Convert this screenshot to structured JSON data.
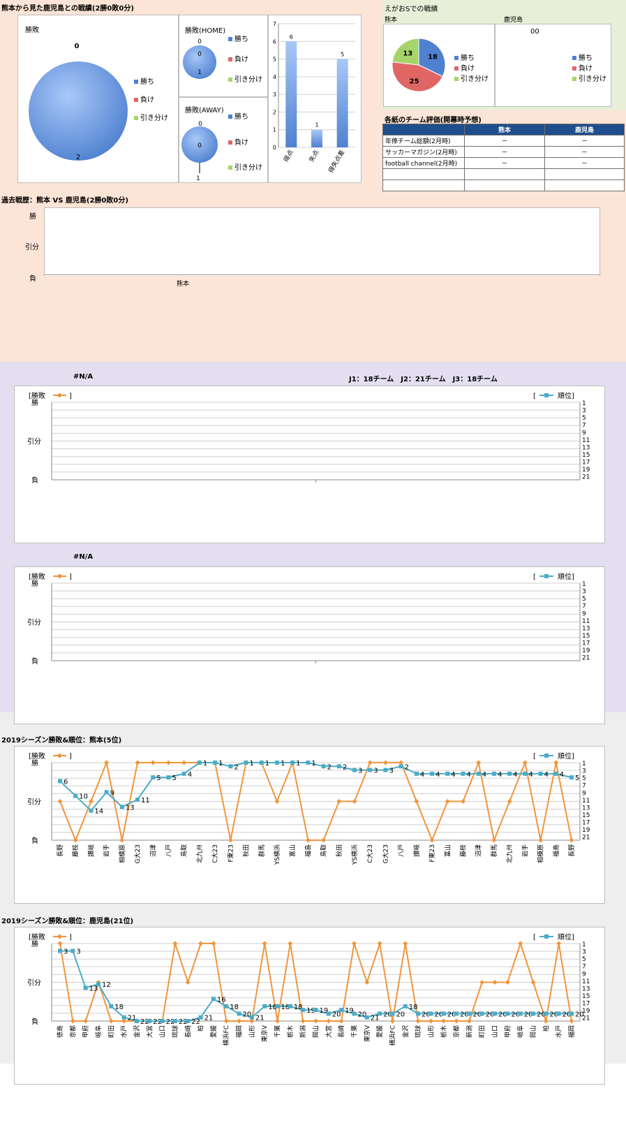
{
  "section1": {
    "title": "熊本から見た鹿児島との戦績(2勝0敗0分)",
    "overall_pie": {
      "label": "勝敗",
      "win": 2,
      "draw": 0
    },
    "home_pie": {
      "label": "勝敗(HOME)",
      "win": 1,
      "loss": 0,
      "draw": 0
    },
    "away_pie": {
      "label": "勝敗(AWAY)",
      "win": 0,
      "loss": 0,
      "draw": 1
    },
    "legend": {
      "win": "勝ち",
      "loss": "負け",
      "draw": "引き分け"
    },
    "goals_bar": {
      "yticks": [
        "0",
        "1",
        "2",
        "3",
        "4",
        "5",
        "6",
        "7"
      ],
      "categories": [
        "得点",
        "失点",
        "得失点差"
      ],
      "values": [
        6,
        1,
        5
      ]
    }
  },
  "egao": {
    "title": "えがおSでの戦績",
    "kumamoto_label": "熊本",
    "kagoshima_label": "鹿児島",
    "kumamoto_pie": {
      "win": 18,
      "loss": 25,
      "draw": 13
    },
    "kagoshima_pie_text": "00"
  },
  "eval_table": {
    "title": "各紙のチーム評価(開幕時予想)",
    "headers": [
      "",
      "熊本",
      "鹿児島"
    ],
    "rows": [
      [
        "年俸チーム総額(2月時)",
        "－",
        "－"
      ],
      [
        "サッカーマガジン(2月時)",
        "－",
        "－"
      ],
      [
        "football channel(2月時)",
        "－",
        "－"
      ],
      [
        "",
        "",
        ""
      ],
      [
        "",
        "",
        ""
      ]
    ]
  },
  "history": {
    "title": "過去戦歴：熊本 VS 鹿児島(2勝0敗0分)",
    "yticks": [
      "勝",
      "引分",
      "負"
    ],
    "xlabel": "熊本"
  },
  "season_block": {
    "na_label": "#N/A",
    "league_info": "J1：18チーム　J2：21チーム　J3：18チーム",
    "legend_result": "[勝敗",
    "legend_close": "]",
    "legend_rank_open": "[",
    "legend_rank": "順位]",
    "result_ticks": [
      "勝",
      "引分",
      "負"
    ],
    "rank_ticks": [
      "1",
      "3",
      "5",
      "7",
      "9",
      "11",
      "13",
      "15",
      "17",
      "19",
      "21"
    ]
  },
  "kumamoto_title": "2019シーズン勝敗&順位：熊本(5位)",
  "kagoshima_title": "2019シーズン勝敗&順位：鹿児島(21位)",
  "chart_data": [
    {
      "type": "pie",
      "title": "勝敗",
      "categories": [
        "勝ち",
        "負け",
        "引き分け"
      ],
      "values": [
        2,
        0,
        0
      ]
    },
    {
      "type": "pie",
      "title": "勝敗(HOME)",
      "categories": [
        "勝ち",
        "負け",
        "引き分け"
      ],
      "values": [
        1,
        0,
        0
      ]
    },
    {
      "type": "pie",
      "title": "勝敗(AWAY)",
      "categories": [
        "勝ち",
        "負け",
        "引き分け"
      ],
      "values": [
        0,
        0,
        1
      ]
    },
    {
      "type": "bar",
      "categories": [
        "得点",
        "失点",
        "得失点差"
      ],
      "values": [
        6,
        1,
        5
      ],
      "ylim": [
        0,
        7
      ]
    },
    {
      "type": "pie",
      "title": "熊本",
      "categories": [
        "勝ち",
        "負け",
        "引き分け"
      ],
      "values": [
        18,
        25,
        13
      ]
    },
    {
      "type": "line",
      "title": "2019シーズン勝敗&順位：熊本(5位)",
      "categories": [
        "長野",
        "藤枝",
        "讃岐",
        "岩手",
        "相模原",
        "G大23",
        "沼津",
        "八戸",
        "鳥取",
        "北九州",
        "C大23",
        "F東23",
        "秋田",
        "群馬",
        "YS横浜",
        "富山",
        "福島",
        "鳥取",
        "秋田",
        "YS横浜",
        "C大23",
        "G大23",
        "八戸",
        "讃岐",
        "F東23",
        "富山",
        "藤枝",
        "沼津",
        "群馬",
        "北九州",
        "岩手",
        "相模原",
        "福島",
        "長野"
      ],
      "series": [
        {
          "name": "勝敗",
          "values": [
            "D",
            "L",
            "D",
            "W",
            "L",
            "W",
            "W",
            "W",
            "W",
            "W",
            "W",
            "L",
            "W",
            "W",
            "D",
            "W",
            "L",
            "L",
            "D",
            "D",
            "W",
            "W",
            "W",
            "D",
            "L",
            "D",
            "D",
            "W",
            "L",
            "D",
            "W",
            "L",
            "W",
            "L"
          ]
        },
        {
          "name": "順位",
          "values": [
            6,
            10,
            14,
            9,
            13,
            11,
            5,
            5,
            4,
            1,
            1,
            2,
            1,
            1,
            1,
            1,
            1,
            2,
            2,
            3,
            3,
            3,
            2,
            4,
            4,
            4,
            4,
            4,
            4,
            4,
            4,
            4,
            4,
            5
          ]
        }
      ]
    },
    {
      "type": "line",
      "title": "2019シーズン勝敗&順位：鹿児島(21位)",
      "categories": [
        "徳島",
        "京都",
        "甲府",
        "岐阜",
        "町田",
        "水戸",
        "金沢",
        "大宮",
        "山口",
        "琉球",
        "長崎",
        "柏",
        "愛媛",
        "横浜FC",
        "福岡",
        "山形",
        "東京V",
        "千葉",
        "栃木",
        "新潟",
        "岡山",
        "大宮",
        "長崎",
        "千葉",
        "東京V",
        "愛媛",
        "横浜FC",
        "金沢",
        "琉球",
        "山形",
        "栃木",
        "京都",
        "新潟",
        "町田",
        "山口",
        "甲府",
        "岐阜",
        "岡山",
        "柏",
        "水戸",
        "福岡"
      ],
      "series": [
        {
          "name": "勝敗",
          "values": [
            "W",
            "L",
            "L",
            "D",
            "L",
            "L",
            "L",
            "L",
            "L",
            "W",
            "D",
            "W",
            "W",
            "L",
            "L",
            "L",
            "W",
            "L",
            "W",
            "L",
            "L",
            "L",
            "L",
            "W",
            "D",
            "W",
            "L",
            "W",
            "L",
            "L",
            "L",
            "L",
            "L",
            "D",
            "D",
            "D",
            "W",
            "D",
            "L",
            "W",
            "L"
          ]
        },
        {
          "name": "順位",
          "values": [
            3,
            3,
            13,
            12,
            18,
            21,
            22,
            22,
            22,
            22,
            22,
            21,
            16,
            18,
            20,
            21,
            18,
            18,
            18,
            19,
            19,
            20,
            19,
            20,
            21,
            20,
            20,
            18,
            20,
            20,
            20,
            20,
            20,
            20,
            20,
            20,
            20,
            20,
            20,
            20,
            20
          ]
        }
      ]
    }
  ]
}
